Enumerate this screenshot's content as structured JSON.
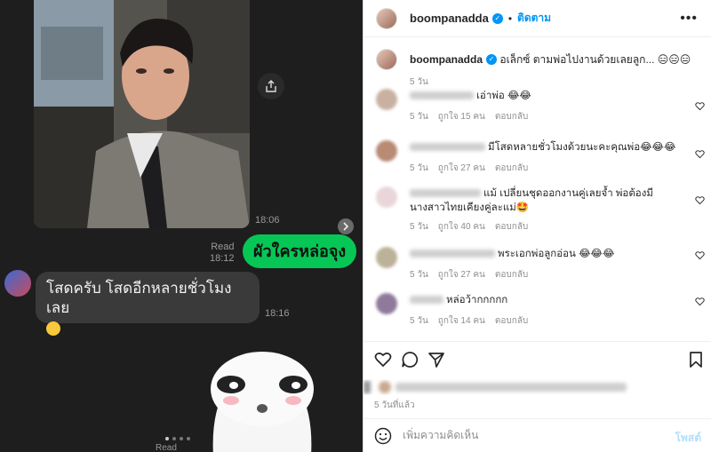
{
  "chat": {
    "photo_time": "18:06",
    "read_label": "Read",
    "read_time": "18:12",
    "outgoing_message": "ผัวใครหล่อจุง",
    "incoming_message": "โสดครับ โสดอีกหลายชั่วโมงเลย",
    "incoming_emoji_icon": "grinning-face-icon",
    "incoming_time": "18:16",
    "bottom_read_label": "Read"
  },
  "post": {
    "username": "boompanadda",
    "follow_label": "ติดตาม",
    "caption_username": "boompanadda",
    "caption_text": "อเล็กซ์ ตามพ่อไปงานด้วยเลยลูก... 😑😑😑",
    "caption_time": "5 วัน",
    "comments": [
      {
        "text": "เอ่าพ่อ 😂😂",
        "time": "5 วัน",
        "likes": "ถูกใจ 15 คน",
        "reply": "ตอบกลับ"
      },
      {
        "text": "มีโสดหลายชั่วโมงด้วยนะคะคุณพ่อ😂😂😂",
        "time": "5 วัน",
        "likes": "ถูกใจ 27 คน",
        "reply": "ตอบกลับ"
      },
      {
        "text": "แม้ เปลี่ยนชุดออกงานคู่เลยจ้ำ พ่อต้องมีนางสาวไทยเคียงคู่ละแม่🤩",
        "time": "5 วัน",
        "likes": "ถูกใจ 40 คน",
        "reply": "ตอบกลับ"
      },
      {
        "text": "พระเอกพ่อลูกอ่อน 😂😂😂",
        "time": "5 วัน",
        "likes": "ถูกใจ 27 คน",
        "reply": "ตอบกลับ"
      },
      {
        "text": "หล่อว้ากกกกก",
        "time": "5 วัน",
        "likes": "ถูกใจ 14 คน",
        "reply": "ตอบกลับ"
      }
    ],
    "posted_time": "5 วันที่แล้ว",
    "comment_placeholder": "เพิ่มความคิดเห็น",
    "post_button": "โพสต์"
  },
  "colors": {
    "line_green": "#06c755",
    "instagram_blue": "#0095f6",
    "chat_bg": "#1e1e1e"
  }
}
